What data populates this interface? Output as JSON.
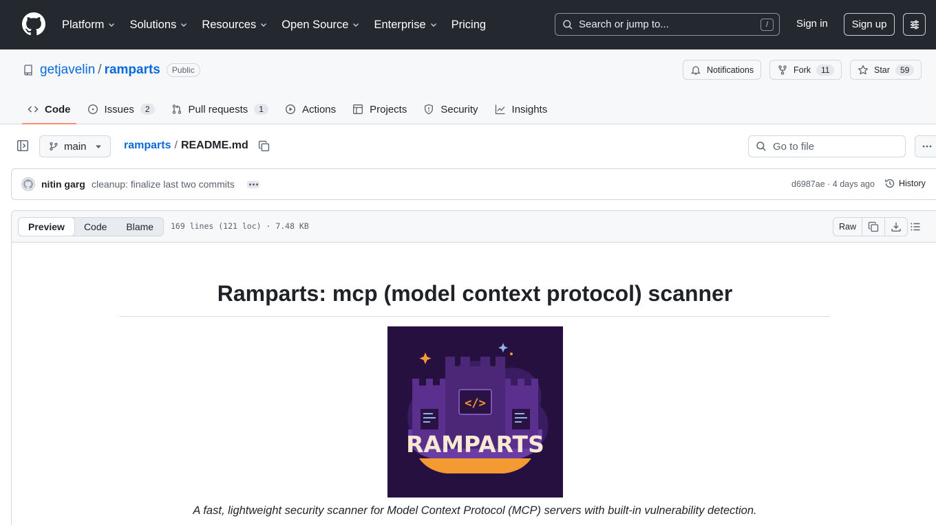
{
  "nav": {
    "items": [
      {
        "label": "Platform",
        "has_caret": true
      },
      {
        "label": "Solutions",
        "has_caret": true
      },
      {
        "label": "Resources",
        "has_caret": true
      },
      {
        "label": "Open Source",
        "has_caret": true
      },
      {
        "label": "Enterprise",
        "has_caret": true
      },
      {
        "label": "Pricing",
        "has_caret": false
      }
    ],
    "search_placeholder": "Search or jump to...",
    "search_shortcut": "/",
    "sign_in": "Sign in",
    "sign_up": "Sign up"
  },
  "repo": {
    "owner": "getjavelin",
    "separator": "/",
    "name": "ramparts",
    "visibility": "Public",
    "notifications_label": "Notifications",
    "fork_label": "Fork",
    "fork_count": "11",
    "star_label": "Star",
    "star_count": "59"
  },
  "tabs": [
    {
      "label": "Code",
      "count": "",
      "icon": "code-icon",
      "active": true
    },
    {
      "label": "Issues",
      "count": "2",
      "icon": "issue-icon",
      "active": false
    },
    {
      "label": "Pull requests",
      "count": "1",
      "icon": "pull-request-icon",
      "active": false
    },
    {
      "label": "Actions",
      "count": "",
      "icon": "play-icon",
      "active": false
    },
    {
      "label": "Projects",
      "count": "",
      "icon": "table-icon",
      "active": false
    },
    {
      "label": "Security",
      "count": "",
      "icon": "shield-icon",
      "active": false
    },
    {
      "label": "Insights",
      "count": "",
      "icon": "graph-icon",
      "active": false
    }
  ],
  "file_nav": {
    "branch": "main",
    "crumb_repo": "ramparts",
    "crumb_sep": "/",
    "crumb_file": "README.md",
    "goto_placeholder": "Go to file"
  },
  "commit": {
    "author": "nitin garg",
    "message": "cleanup: finalize last two commits",
    "sha_time": "d6987ae · 4 days ago",
    "history_label": "History"
  },
  "file": {
    "views": [
      "Preview",
      "Code",
      "Blame"
    ],
    "active_view": "Preview",
    "meta": "169 lines (121 loc) · 7.48 KB",
    "raw_label": "Raw"
  },
  "readme": {
    "title": "Ramparts: mcp (model context protocol) scanner",
    "logo_text": "RAMPARTS",
    "tagline": "A fast, lightweight security scanner for Model Context Protocol (MCP) servers with built-in vulnerability detection."
  },
  "colors": {
    "header_bg": "#24292f",
    "link": "#0969da",
    "active_tab_underline": "#fd8c73",
    "logo_bg": "#261040",
    "logo_purple": "#6b3ca4",
    "logo_orange": "#f39a33"
  }
}
